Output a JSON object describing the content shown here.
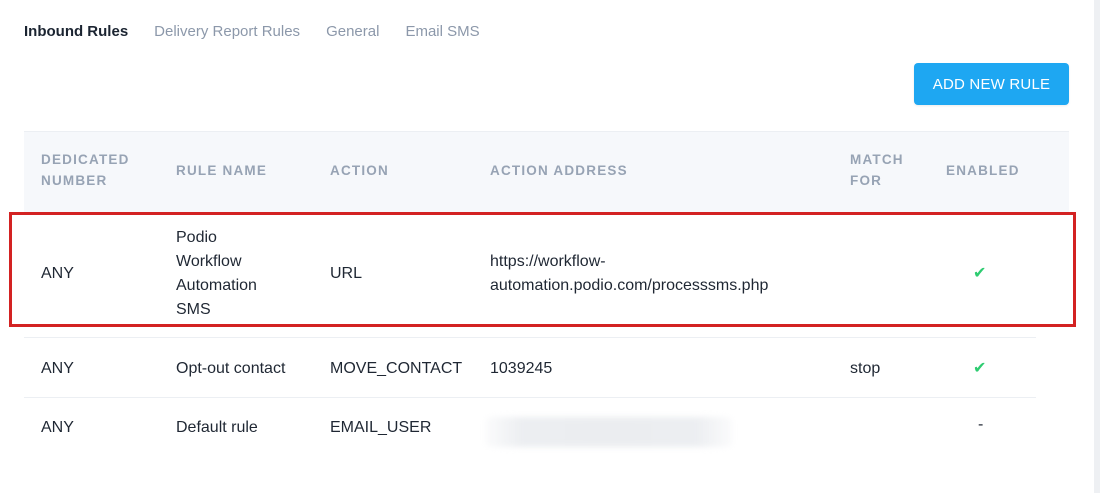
{
  "tabs": [
    {
      "label": "Inbound Rules",
      "active": true
    },
    {
      "label": "Delivery Report Rules",
      "active": false
    },
    {
      "label": "General",
      "active": false
    },
    {
      "label": "Email SMS",
      "active": false
    }
  ],
  "add_button_label": "ADD NEW RULE",
  "table": {
    "headers": {
      "dedicated_number": "DEDICATED\nNUMBER",
      "rule_name": "RULE NAME",
      "action": "ACTION",
      "action_address": "ACTION ADDRESS",
      "match_for": "MATCH\nFOR",
      "enabled": "ENABLED"
    },
    "rows": [
      {
        "dedicated_number": "ANY",
        "rule_name": "Podio\nWorkflow\nAutomation\nSMS",
        "action": "URL",
        "action_address": "https://workflow-\nautomation.podio.com/processsms.php",
        "match_for": "",
        "enabled": "✔"
      },
      {
        "dedicated_number": "ANY",
        "rule_name": "Opt-out contact",
        "action": "MOVE_CONTACT",
        "action_address": "1039245",
        "match_for": "stop",
        "enabled": "✔"
      },
      {
        "dedicated_number": "ANY",
        "rule_name": "Default rule",
        "action": "EMAIL_USER",
        "action_address": "",
        "match_for": "",
        "enabled": "-"
      }
    ]
  },
  "colors": {
    "accent": "#1ea7f2",
    "check": "#2ecc71",
    "highlight": "#d32222",
    "header_text": "#97a3b4"
  }
}
